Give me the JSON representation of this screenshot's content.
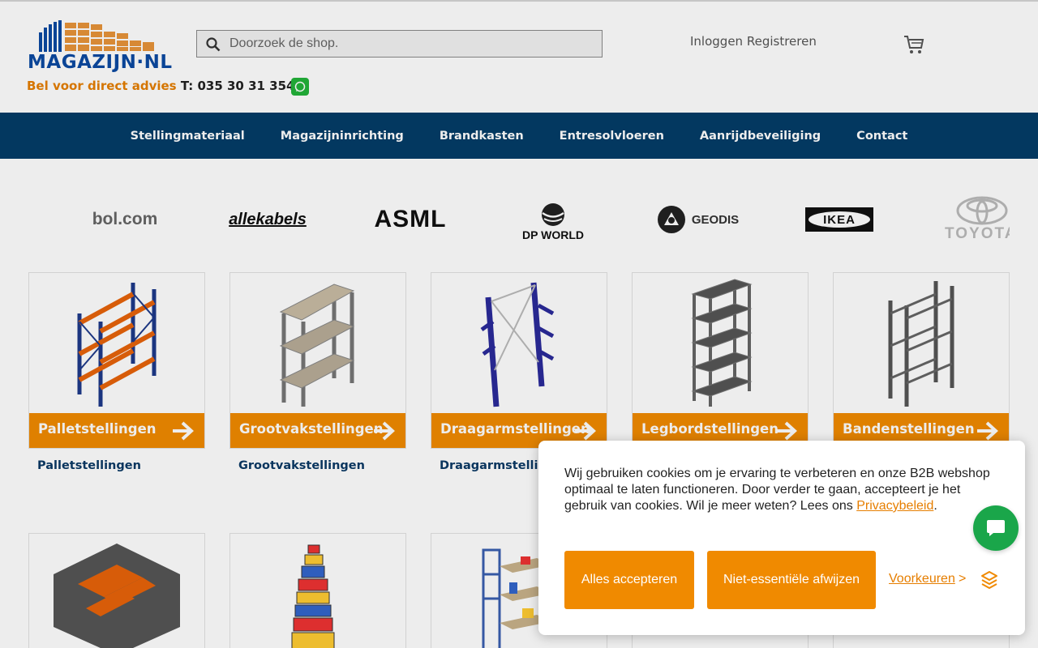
{
  "header": {
    "logo_text": "MAGAZIJN·NL",
    "phone_prefix": "Bel voor direct advies",
    "phone_number": "T: 035 30 31 354",
    "search_placeholder": "Doorzoek de shop.",
    "login_label": "Inloggen",
    "register_label": "Registreren"
  },
  "nav": {
    "items": [
      "Stellingmateriaal",
      "Magazijninrichting",
      "Brandkasten",
      "Entresolvloeren",
      "Aanrijdbeveiliging",
      "Contact"
    ]
  },
  "brands": {
    "bol": "bol.com",
    "allekabels": "allekabels",
    "asml": "ASML",
    "dpworld": "DP WORLD",
    "geodis": "GEODIS",
    "ikea": "IKEA",
    "toyota": "TOYOTA"
  },
  "categories": [
    {
      "label": "Palletstellingen",
      "link": "Palletstellingen"
    },
    {
      "label": "Grootvakstellingen",
      "link": "Grootvakstellingen"
    },
    {
      "label": "Draagarmstellingen",
      "link": "Draagarmstelling"
    },
    {
      "label": "Legbordstellingen",
      "link": ""
    },
    {
      "label": "Bandenstellingen",
      "link": ""
    }
  ],
  "cookie": {
    "text": "Wij gebruiken cookies om je ervaring te verbeteren en onze B2B webshop optimaal te laten functioneren. Door verder te gaan, accepteert je het gebruik van cookies. Wil je meer weten? Lees ons ",
    "privacy_link": "Privacybeleid",
    "text_end": ".",
    "accept_label": "Alles accepteren",
    "reject_label": "Niet-essentiële afwijzen",
    "preferences_label": "Voorkeuren",
    "preferences_arrow": ">"
  },
  "colors": {
    "accent": "#f08a00",
    "nav_bg": "#043d68",
    "link": "#0b3a66",
    "chat": "#1aa64a"
  }
}
